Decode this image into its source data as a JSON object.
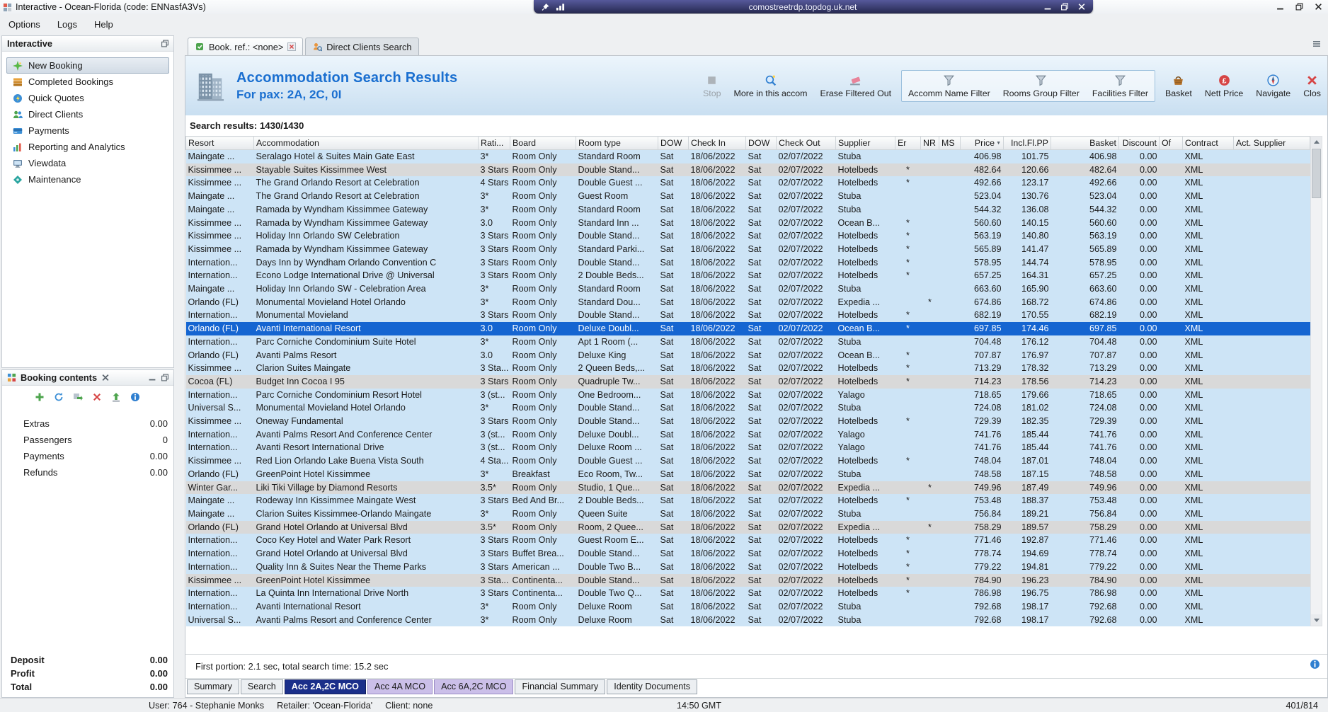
{
  "titlebar": {
    "app_title": "Interactive - Ocean-Florida (code: ENNasfA3Vs)",
    "rdp_address": "comostreetrdp.topdog.uk.net"
  },
  "menubar": {
    "items": [
      "Options",
      "Logs",
      "Help"
    ]
  },
  "sidebar": {
    "title": "Interactive",
    "items": [
      {
        "label": "New Booking",
        "icon": "new-booking-icon",
        "selected": true
      },
      {
        "label": "Completed Bookings",
        "icon": "completed-bookings-icon"
      },
      {
        "label": "Quick Quotes",
        "icon": "quick-quotes-icon"
      },
      {
        "label": "Direct Clients",
        "icon": "direct-clients-icon"
      },
      {
        "label": "Payments",
        "icon": "payments-icon"
      },
      {
        "label": "Reporting and Analytics",
        "icon": "reporting-icon"
      },
      {
        "label": "Viewdata",
        "icon": "viewdata-icon"
      },
      {
        "label": "Maintenance",
        "icon": "maintenance-icon"
      }
    ]
  },
  "booking_contents": {
    "title": "Booking contents",
    "toolbar_icons": [
      "add-icon",
      "refresh-icon",
      "transfer-icon",
      "delete-icon",
      "upload-icon",
      "info-icon"
    ],
    "rows": [
      {
        "label": "Extras",
        "value": "0.00"
      },
      {
        "label": "Passengers",
        "value": "0"
      },
      {
        "label": "Payments",
        "value": "0.00"
      },
      {
        "label": "Refunds",
        "value": "0.00"
      }
    ],
    "totals": [
      {
        "label": "Deposit",
        "value": "0.00"
      },
      {
        "label": "Profit",
        "value": "0.00"
      },
      {
        "label": "Total",
        "value": "0.00"
      }
    ]
  },
  "tabs": [
    {
      "label": "Book. ref.: <none>",
      "icon": "booking-tab-icon",
      "closable": true,
      "active": true
    },
    {
      "label": "Direct Clients Search",
      "icon": "clients-search-icon",
      "closable": false,
      "active": false
    }
  ],
  "header": {
    "title": "Accommodation Search Results",
    "subtitle": "For pax: 2A, 2C, 0I",
    "buttons": [
      {
        "label": "Stop",
        "icon": "stop-icon",
        "enabled": false
      },
      {
        "label": "More in this accom",
        "icon": "search-accom-icon"
      },
      {
        "label": "Erase Filtered Out",
        "icon": "eraser-icon"
      },
      {
        "label": "Accomm Name Filter",
        "icon": "filter-icon",
        "group": true
      },
      {
        "label": "Rooms Group Filter",
        "icon": "filter-icon",
        "group": true
      },
      {
        "label": "Facilities Filter",
        "icon": "filter-icon",
        "group": true
      },
      {
        "label": "Basket",
        "icon": "basket-icon"
      },
      {
        "label": "Nett Price",
        "icon": "nett-price-icon"
      },
      {
        "label": "Navigate",
        "icon": "navigate-icon"
      },
      {
        "label": "Clos",
        "icon": "close-icon"
      }
    ]
  },
  "results": {
    "label": "Search results: 1430/1430",
    "columns": [
      "Resort",
      "Accommodation",
      "Rati...",
      "Board",
      "Room type",
      "DOW",
      "Check In",
      "DOW",
      "Check Out",
      "Supplier",
      "Er",
      "NR",
      "MS",
      "Price",
      "Incl.Fl.PP",
      "Basket",
      "Discount",
      "Of",
      "Contract",
      "Act. Supplier"
    ],
    "selected_index": 13,
    "gray_indices": [
      1,
      17,
      25,
      28,
      32
    ],
    "rows": [
      [
        "Maingate ...",
        "Seralago Hotel & Suites Main Gate East",
        "3*",
        "Room Only",
        "Standard Room",
        "Sat",
        "18/06/2022",
        "Sat",
        "02/07/2022",
        "Stuba",
        "",
        "",
        "",
        "406.98",
        "101.75",
        "406.98",
        "0.00",
        "",
        "XML",
        ""
      ],
      [
        "Kissimmee ...",
        "Stayable Suites Kissimmee West",
        "3 Stars",
        "Room Only",
        "Double Stand...",
        "Sat",
        "18/06/2022",
        "Sat",
        "02/07/2022",
        "Hotelbeds",
        "*",
        "",
        "",
        "482.64",
        "120.66",
        "482.64",
        "0.00",
        "",
        "XML",
        ""
      ],
      [
        "Kissimmee ...",
        "The Grand Orlando Resort at Celebration",
        "4 Stars",
        "Room Only",
        "Double Guest ...",
        "Sat",
        "18/06/2022",
        "Sat",
        "02/07/2022",
        "Hotelbeds",
        "*",
        "",
        "",
        "492.66",
        "123.17",
        "492.66",
        "0.00",
        "",
        "XML",
        ""
      ],
      [
        "Maingate ...",
        "The Grand Orlando Resort at Celebration",
        "3*",
        "Room Only",
        "Guest Room",
        "Sat",
        "18/06/2022",
        "Sat",
        "02/07/2022",
        "Stuba",
        "",
        "",
        "",
        "523.04",
        "130.76",
        "523.04",
        "0.00",
        "",
        "XML",
        ""
      ],
      [
        "Maingate ...",
        "Ramada by Wyndham Kissimmee Gateway",
        "3*",
        "Room Only",
        "Standard Room",
        "Sat",
        "18/06/2022",
        "Sat",
        "02/07/2022",
        "Stuba",
        "",
        "",
        "",
        "544.32",
        "136.08",
        "544.32",
        "0.00",
        "",
        "XML",
        ""
      ],
      [
        "Kissimmee ...",
        "Ramada by Wyndham Kissimmee Gateway",
        "3.0",
        "Room Only",
        "Standard Inn ...",
        "Sat",
        "18/06/2022",
        "Sat",
        "02/07/2022",
        "Ocean B...",
        "*",
        "",
        "",
        "560.60",
        "140.15",
        "560.60",
        "0.00",
        "",
        "XML",
        ""
      ],
      [
        "Kissimmee ...",
        "Holiday Inn Orlando SW Celebration",
        "3 Stars",
        "Room Only",
        "Double Stand...",
        "Sat",
        "18/06/2022",
        "Sat",
        "02/07/2022",
        "Hotelbeds",
        "*",
        "",
        "",
        "563.19",
        "140.80",
        "563.19",
        "0.00",
        "",
        "XML",
        ""
      ],
      [
        "Kissimmee ...",
        "Ramada by Wyndham Kissimmee Gateway",
        "3 Stars",
        "Room Only",
        "Standard Parki...",
        "Sat",
        "18/06/2022",
        "Sat",
        "02/07/2022",
        "Hotelbeds",
        "*",
        "",
        "",
        "565.89",
        "141.47",
        "565.89",
        "0.00",
        "",
        "XML",
        ""
      ],
      [
        "Internation...",
        "Days Inn by Wyndham Orlando Convention C",
        "3 Stars",
        "Room Only",
        "Double Stand...",
        "Sat",
        "18/06/2022",
        "Sat",
        "02/07/2022",
        "Hotelbeds",
        "*",
        "",
        "",
        "578.95",
        "144.74",
        "578.95",
        "0.00",
        "",
        "XML",
        ""
      ],
      [
        "Internation...",
        "Econo Lodge International Drive @ Universal",
        "3 Stars",
        "Room Only",
        "2 Double Beds...",
        "Sat",
        "18/06/2022",
        "Sat",
        "02/07/2022",
        "Hotelbeds",
        "*",
        "",
        "",
        "657.25",
        "164.31",
        "657.25",
        "0.00",
        "",
        "XML",
        ""
      ],
      [
        "Maingate ...",
        "Holiday Inn Orlando SW - Celebration Area",
        "3*",
        "Room Only",
        "Standard Room",
        "Sat",
        "18/06/2022",
        "Sat",
        "02/07/2022",
        "Stuba",
        "",
        "",
        "",
        "663.60",
        "165.90",
        "663.60",
        "0.00",
        "",
        "XML",
        ""
      ],
      [
        "Orlando (FL)",
        "Monumental Movieland Hotel Orlando",
        "3*",
        "Room Only",
        "Standard Dou...",
        "Sat",
        "18/06/2022",
        "Sat",
        "02/07/2022",
        "Expedia ...",
        "",
        "*",
        "",
        "674.86",
        "168.72",
        "674.86",
        "0.00",
        "",
        "XML",
        ""
      ],
      [
        "Internation...",
        "Monumental Movieland",
        "3 Stars",
        "Room Only",
        "Double Stand...",
        "Sat",
        "18/06/2022",
        "Sat",
        "02/07/2022",
        "Hotelbeds",
        "*",
        "",
        "",
        "682.19",
        "170.55",
        "682.19",
        "0.00",
        "",
        "XML",
        ""
      ],
      [
        "Orlando (FL)",
        "Avanti International Resort",
        "3.0",
        "Room Only",
        "Deluxe Doubl...",
        "Sat",
        "18/06/2022",
        "Sat",
        "02/07/2022",
        "Ocean B...",
        "*",
        "",
        "",
        "697.85",
        "174.46",
        "697.85",
        "0.00",
        "",
        "XML",
        ""
      ],
      [
        "Internation...",
        "Parc Corniche Condominium Suite Hotel",
        "3*",
        "Room Only",
        "Apt 1 Room (...",
        "Sat",
        "18/06/2022",
        "Sat",
        "02/07/2022",
        "Stuba",
        "",
        "",
        "",
        "704.48",
        "176.12",
        "704.48",
        "0.00",
        "",
        "XML",
        ""
      ],
      [
        "Orlando (FL)",
        "Avanti Palms Resort",
        "3.0",
        "Room Only",
        "Deluxe King",
        "Sat",
        "18/06/2022",
        "Sat",
        "02/07/2022",
        "Ocean B...",
        "*",
        "",
        "",
        "707.87",
        "176.97",
        "707.87",
        "0.00",
        "",
        "XML",
        ""
      ],
      [
        "Kissimmee ...",
        "Clarion Suites Maingate",
        "3 Sta...",
        "Room Only",
        "2 Queen Beds,...",
        "Sat",
        "18/06/2022",
        "Sat",
        "02/07/2022",
        "Hotelbeds",
        "*",
        "",
        "",
        "713.29",
        "178.32",
        "713.29",
        "0.00",
        "",
        "XML",
        ""
      ],
      [
        "Cocoa (FL)",
        "Budget Inn Cocoa I 95",
        "3 Stars",
        "Room Only",
        "Quadruple Tw...",
        "Sat",
        "18/06/2022",
        "Sat",
        "02/07/2022",
        "Hotelbeds",
        "*",
        "",
        "",
        "714.23",
        "178.56",
        "714.23",
        "0.00",
        "",
        "XML",
        ""
      ],
      [
        "Internation...",
        "Parc Corniche Condominium Resort Hotel",
        "3 (st...",
        "Room Only",
        "One Bedroom...",
        "Sat",
        "18/06/2022",
        "Sat",
        "02/07/2022",
        "Yalago",
        "",
        "",
        "",
        "718.65",
        "179.66",
        "718.65",
        "0.00",
        "",
        "XML",
        ""
      ],
      [
        "Universal S...",
        "Monumental Movieland Hotel Orlando",
        "3*",
        "Room Only",
        "Double Stand...",
        "Sat",
        "18/06/2022",
        "Sat",
        "02/07/2022",
        "Stuba",
        "",
        "",
        "",
        "724.08",
        "181.02",
        "724.08",
        "0.00",
        "",
        "XML",
        ""
      ],
      [
        "Kissimmee ...",
        "Oneway Fundamental",
        "3 Stars",
        "Room Only",
        "Double Stand...",
        "Sat",
        "18/06/2022",
        "Sat",
        "02/07/2022",
        "Hotelbeds",
        "*",
        "",
        "",
        "729.39",
        "182.35",
        "729.39",
        "0.00",
        "",
        "XML",
        ""
      ],
      [
        "Internation...",
        "Avanti Palms Resort And Conference Center",
        "3 (st...",
        "Room Only",
        "Deluxe Doubl...",
        "Sat",
        "18/06/2022",
        "Sat",
        "02/07/2022",
        "Yalago",
        "",
        "",
        "",
        "741.76",
        "185.44",
        "741.76",
        "0.00",
        "",
        "XML",
        ""
      ],
      [
        "Internation...",
        "Avanti Resort International Drive",
        "3 (st...",
        "Room Only",
        "Deluxe Room ...",
        "Sat",
        "18/06/2022",
        "Sat",
        "02/07/2022",
        "Yalago",
        "",
        "",
        "",
        "741.76",
        "185.44",
        "741.76",
        "0.00",
        "",
        "XML",
        ""
      ],
      [
        "Kissimmee ...",
        "Red Lion Orlando Lake Buena Vista South",
        "4 Sta...",
        "Room Only",
        "Double Guest ...",
        "Sat",
        "18/06/2022",
        "Sat",
        "02/07/2022",
        "Hotelbeds",
        "*",
        "",
        "",
        "748.04",
        "187.01",
        "748.04",
        "0.00",
        "",
        "XML",
        ""
      ],
      [
        "Orlando (FL)",
        "GreenPoint Hotel Kissimmee",
        "3*",
        "Breakfast",
        "Eco Room, Tw...",
        "Sat",
        "18/06/2022",
        "Sat",
        "02/07/2022",
        "Stuba",
        "",
        "",
        "",
        "748.58",
        "187.15",
        "748.58",
        "0.00",
        "",
        "XML",
        ""
      ],
      [
        "Winter Gar...",
        "Liki Tiki Village by Diamond Resorts",
        "3.5*",
        "Room Only",
        "Studio, 1 Que...",
        "Sat",
        "18/06/2022",
        "Sat",
        "02/07/2022",
        "Expedia ...",
        "",
        "*",
        "",
        "749.96",
        "187.49",
        "749.96",
        "0.00",
        "",
        "XML",
        ""
      ],
      [
        "Maingate ...",
        "Rodeway Inn Kissimmee Maingate West",
        "3 Stars",
        "Bed And Br...",
        "2 Double Beds...",
        "Sat",
        "18/06/2022",
        "Sat",
        "02/07/2022",
        "Hotelbeds",
        "*",
        "",
        "",
        "753.48",
        "188.37",
        "753.48",
        "0.00",
        "",
        "XML",
        ""
      ],
      [
        "Maingate ...",
        "Clarion Suites Kissimmee-Orlando Maingate",
        "3*",
        "Room Only",
        "Queen Suite",
        "Sat",
        "18/06/2022",
        "Sat",
        "02/07/2022",
        "Stuba",
        "",
        "",
        "",
        "756.84",
        "189.21",
        "756.84",
        "0.00",
        "",
        "XML",
        ""
      ],
      [
        "Orlando (FL)",
        "Grand Hotel Orlando at Universal Blvd",
        "3.5*",
        "Room Only",
        "Room, 2 Quee...",
        "Sat",
        "18/06/2022",
        "Sat",
        "02/07/2022",
        "Expedia ...",
        "",
        "*",
        "",
        "758.29",
        "189.57",
        "758.29",
        "0.00",
        "",
        "XML",
        ""
      ],
      [
        "Internation...",
        "Coco Key Hotel and Water Park Resort",
        "3 Stars",
        "Room Only",
        "Guest Room E...",
        "Sat",
        "18/06/2022",
        "Sat",
        "02/07/2022",
        "Hotelbeds",
        "*",
        "",
        "",
        "771.46",
        "192.87",
        "771.46",
        "0.00",
        "",
        "XML",
        ""
      ],
      [
        "Internation...",
        "Grand Hotel Orlando at Universal Blvd",
        "3 Stars",
        "Buffet Brea...",
        "Double Stand...",
        "Sat",
        "18/06/2022",
        "Sat",
        "02/07/2022",
        "Hotelbeds",
        "*",
        "",
        "",
        "778.74",
        "194.69",
        "778.74",
        "0.00",
        "",
        "XML",
        ""
      ],
      [
        "Internation...",
        "Quality Inn & Suites Near the Theme Parks",
        "3 Stars",
        "American ...",
        "Double Two B...",
        "Sat",
        "18/06/2022",
        "Sat",
        "02/07/2022",
        "Hotelbeds",
        "*",
        "",
        "",
        "779.22",
        "194.81",
        "779.22",
        "0.00",
        "",
        "XML",
        ""
      ],
      [
        "Kissimmee ...",
        "GreenPoint Hotel Kissimmee",
        "3 Sta...",
        "Continenta...",
        "Double Stand...",
        "Sat",
        "18/06/2022",
        "Sat",
        "02/07/2022",
        "Hotelbeds",
        "*",
        "",
        "",
        "784.90",
        "196.23",
        "784.90",
        "0.00",
        "",
        "XML",
        ""
      ],
      [
        "Internation...",
        "La Quinta Inn International Drive North",
        "3 Stars",
        "Continenta...",
        "Double Two Q...",
        "Sat",
        "18/06/2022",
        "Sat",
        "02/07/2022",
        "Hotelbeds",
        "*",
        "",
        "",
        "786.98",
        "196.75",
        "786.98",
        "0.00",
        "",
        "XML",
        ""
      ],
      [
        "Internation...",
        "Avanti International Resort",
        "3*",
        "Room Only",
        "Deluxe Room",
        "Sat",
        "18/06/2022",
        "Sat",
        "02/07/2022",
        "Stuba",
        "",
        "",
        "",
        "792.68",
        "198.17",
        "792.68",
        "0.00",
        "",
        "XML",
        ""
      ],
      [
        "Universal S...",
        "Avanti Palms Resort and Conference Center",
        "3*",
        "Room Only",
        "Deluxe Room",
        "Sat",
        "18/06/2022",
        "Sat",
        "02/07/2022",
        "Stuba",
        "",
        "",
        "",
        "792.68",
        "198.17",
        "792.68",
        "0.00",
        "",
        "XML",
        ""
      ]
    ]
  },
  "footer": {
    "timing": "First portion: 2.1 sec, total search time: 15.2 sec",
    "tabs": [
      {
        "label": "Summary"
      },
      {
        "label": "Search"
      },
      {
        "label": "Acc 2A,2C MCO",
        "variant": "dark"
      },
      {
        "label": "Acc 4A MCO",
        "variant": "purple"
      },
      {
        "label": "Acc 6A,2C MCO",
        "variant": "purple"
      },
      {
        "label": "Financial Summary"
      },
      {
        "label": "Identity Documents"
      }
    ]
  },
  "statusbar": {
    "segments": [
      "User: 764 - Stephanie Monks",
      "Retailer: 'Ocean-Florida'",
      "Client: none"
    ],
    "time": "14:50 GMT",
    "counter": "401/814"
  },
  "colors": {
    "accent_blue": "#1a6fd0",
    "selected_row": "#1565d1",
    "row_blue": "#cde4f6",
    "row_gray": "#d9d9d9",
    "tab_dark": "#1b2f8a",
    "tab_purple": "#cbbfe9"
  }
}
